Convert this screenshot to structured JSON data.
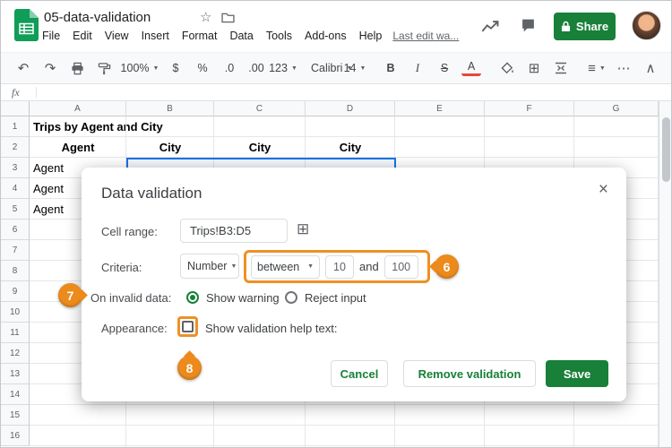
{
  "topbar": {
    "doc_title": "05-data-validation",
    "menus": [
      "File",
      "Edit",
      "View",
      "Insert",
      "Format",
      "Data",
      "Tools",
      "Add-ons",
      "Help"
    ],
    "last_edit": "Last edit wa...",
    "share_label": "Share"
  },
  "toolbar": {
    "zoom": "100%",
    "currency": "$",
    "percent": "%",
    "decimal_decrease": ".0",
    "decimal_increase": ".00",
    "more_formats": "123",
    "font_name": "Calibri",
    "font_size": "14",
    "bold": "B",
    "italic": "I",
    "strikethrough": "S",
    "text_color": "A"
  },
  "formula_bar": {
    "fx": "fx"
  },
  "grid": {
    "columns": [
      "A",
      "B",
      "C",
      "D",
      "E",
      "F",
      "G"
    ],
    "row_numbers": [
      "1",
      "2",
      "3",
      "4",
      "5",
      "6",
      "7",
      "8",
      "9",
      "10",
      "11",
      "12",
      "13",
      "14",
      "15",
      "16"
    ],
    "cells": {
      "a1": "Trips by Agent and City",
      "a2": "Agent",
      "b2": "City",
      "c2": "City",
      "d2": "City",
      "a3": "Agent",
      "a4": "Agent",
      "a5": "Agent"
    }
  },
  "dialog": {
    "title": "Data validation",
    "cell_range": {
      "label": "Cell range:",
      "value": "Trips!B3:D5"
    },
    "criteria": {
      "label": "Criteria:",
      "type": "Number",
      "operator": "between",
      "min": "10",
      "and": "and",
      "max": "100"
    },
    "invalid": {
      "label": "On invalid data:",
      "warning": "Show warning",
      "reject": "Reject input"
    },
    "appearance": {
      "label": "Appearance:",
      "help_text": "Show validation help text:"
    },
    "buttons": {
      "cancel": "Cancel",
      "remove": "Remove validation",
      "save": "Save"
    }
  },
  "badges": {
    "b6": "6",
    "b7": "7",
    "b8": "8"
  },
  "icons": {
    "undo": "↶",
    "redo": "↷",
    "star": "☆",
    "borders": "⊞",
    "table": "⊞",
    "align": "≡",
    "more": "⋯",
    "collapse": "∧",
    "arrow": "▼",
    "close": "×"
  },
  "colors": {
    "sheets_green": "#188038",
    "annotation_orange": "#ec8a1c",
    "selection_blue": "#1a73e8"
  }
}
